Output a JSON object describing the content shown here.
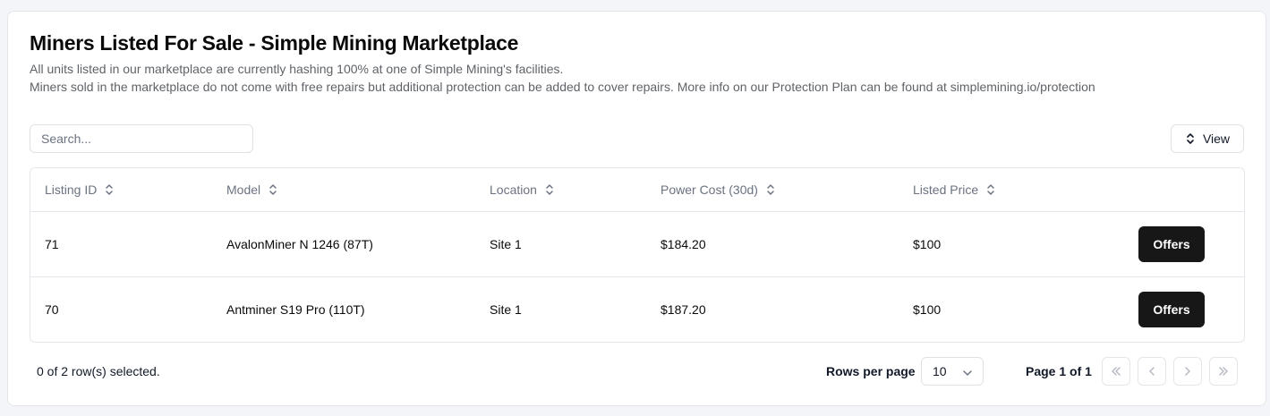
{
  "page": {
    "title": "Miners Listed For Sale - Simple Mining Marketplace",
    "description_line1": "All units listed in our marketplace are currently hashing 100% at one of Simple Mining's facilities.",
    "description_line2": "Miners sold in the marketplace do not come with free repairs but additional protection can be added to cover repairs. More info on our Protection Plan can be found at simplemining.io/protection"
  },
  "toolbar": {
    "search_placeholder": "Search...",
    "search_value": "",
    "view_label": "View",
    "view_icon": "chevrons-up-down-icon"
  },
  "table": {
    "columns": [
      {
        "label": "Listing ID",
        "icon": "sort-icon"
      },
      {
        "label": "Model",
        "icon": "sort-icon"
      },
      {
        "label": "Location",
        "icon": "sort-icon"
      },
      {
        "label": "Power Cost (30d)",
        "icon": "sort-icon"
      },
      {
        "label": "Listed Price",
        "icon": "sort-icon"
      }
    ],
    "rows": [
      {
        "listing_id": "71",
        "model": "AvalonMiner N 1246 (87T)",
        "location": "Site 1",
        "power_cost": "$184.20",
        "listed_price": "$100",
        "action": "Offers"
      },
      {
        "listing_id": "70",
        "model": "Antminer S19 Pro (110T)",
        "location": "Site 1",
        "power_cost": "$187.20",
        "listed_price": "$100",
        "action": "Offers"
      }
    ]
  },
  "footer": {
    "selection_text": "0 of 2 row(s) selected.",
    "rows_per_page_label": "Rows per page",
    "rows_per_page_value": "10",
    "page_info": "Page 1 of 1",
    "pagination_icons": [
      "chevrons-left-icon",
      "chevron-left-icon",
      "chevron-right-icon",
      "chevrons-right-icon"
    ]
  },
  "colors": {
    "primary_button": "#171717",
    "border": "#e4e6eb",
    "muted_text": "#6b7280",
    "background": "#f4f5f8"
  }
}
